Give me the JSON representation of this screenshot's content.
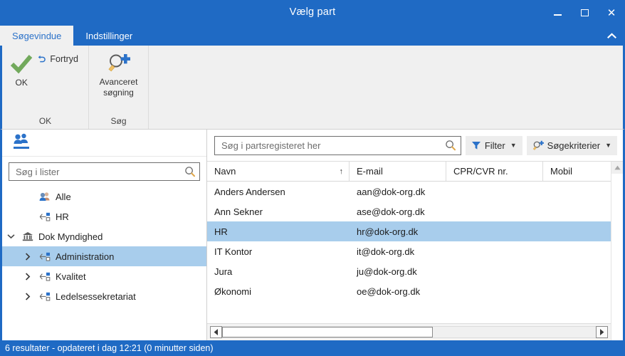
{
  "window": {
    "title": "Vælg part",
    "minimize_label": "–",
    "maximize_label": "□",
    "close_label": "✕"
  },
  "ribbon": {
    "tabs": [
      {
        "label": "Søgevindue",
        "active": true
      },
      {
        "label": "Indstillinger",
        "active": false
      }
    ],
    "collapse_label": "⌃",
    "groups": [
      {
        "name": "ok-group",
        "label": "OK",
        "buttons": [
          {
            "label": "OK",
            "icon": "checkmark-icon"
          },
          {
            "label": "Fortryd",
            "icon": "undo-icon"
          }
        ]
      },
      {
        "name": "soeg-group",
        "label": "Søg",
        "buttons": [
          {
            "label": "Avanceret søgning",
            "icon": "magnifier-plus-icon"
          }
        ]
      }
    ]
  },
  "sidebar": {
    "panel_icon": "people-icon",
    "search": {
      "placeholder": "Søg i lister",
      "value": "",
      "icon": "search-icon"
    },
    "tree": [
      {
        "label": "Alle",
        "icon": "all-parties-icon",
        "indent": 1,
        "expander": "",
        "selected": false
      },
      {
        "label": "HR",
        "icon": "org-unit-icon",
        "indent": 1,
        "expander": "",
        "selected": false
      },
      {
        "label": "Dok Myndighed",
        "icon": "authority-icon",
        "indent": 0,
        "expander": "⌄",
        "selected": false
      },
      {
        "label": "Administration",
        "icon": "org-unit-icon",
        "indent": 1,
        "expander": "›",
        "selected": true
      },
      {
        "label": "Kvalitet",
        "icon": "org-unit-icon",
        "indent": 1,
        "expander": "›",
        "selected": false
      },
      {
        "label": "Ledelsessekretariat",
        "icon": "org-unit-icon",
        "indent": 1,
        "expander": "›",
        "selected": false
      }
    ]
  },
  "main": {
    "search": {
      "placeholder": "Søg i partsregisteret her",
      "value": "",
      "icon": "search-icon"
    },
    "filter_button": {
      "label": "Filter",
      "icon": "funnel-icon",
      "caret": "▼"
    },
    "criteria_button": {
      "label": "Søgekriterier",
      "icon": "magnifier-plus-icon",
      "caret": "▼"
    },
    "table": {
      "columns": [
        {
          "label": "Navn",
          "sort": "↑"
        },
        {
          "label": "E-mail",
          "sort": ""
        },
        {
          "label": "CPR/CVR nr.",
          "sort": ""
        },
        {
          "label": "Mobil",
          "sort": ""
        }
      ],
      "rows": [
        {
          "navn": "Anders Andersen",
          "email": "aan@dok-org.dk",
          "cpr": "",
          "mobil": "",
          "selected": false
        },
        {
          "navn": "Ann Sekner",
          "email": "ase@dok-org.dk",
          "cpr": "",
          "mobil": "",
          "selected": false
        },
        {
          "navn": "HR",
          "email": "hr@dok-org.dk",
          "cpr": "",
          "mobil": "",
          "selected": true
        },
        {
          "navn": "IT Kontor",
          "email": "it@dok-org.dk",
          "cpr": "",
          "mobil": "",
          "selected": false
        },
        {
          "navn": "Jura",
          "email": "ju@dok-org.dk",
          "cpr": "",
          "mobil": "",
          "selected": false
        },
        {
          "navn": "Økonomi",
          "email": "oe@dok-org.dk",
          "cpr": "",
          "mobil": "",
          "selected": false
        }
      ]
    },
    "scroll": {
      "up_arrow": "▲",
      "left_arrow": "◀",
      "right_arrow": "▶"
    }
  },
  "status": {
    "text": "6 resultater - opdateret i dag 12:21 (0 minutter siden)"
  },
  "colors": {
    "window_chrome": "#1f6ac4",
    "selection": "#a8cdec",
    "ribbon_bg": "#f0f0f0",
    "accent_blue": "#2b72c9",
    "check_green": "#6aa84f"
  }
}
